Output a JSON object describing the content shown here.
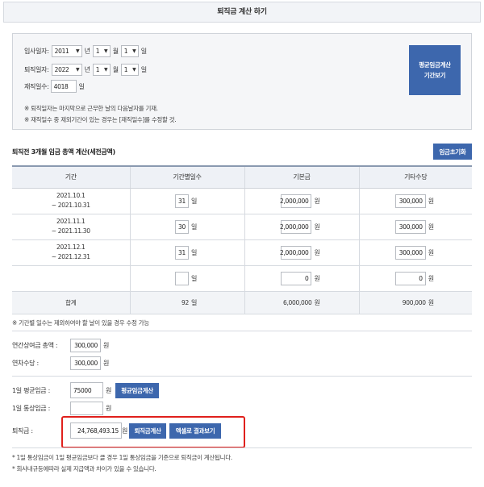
{
  "header": {
    "title": "퇴직금 계산 하기"
  },
  "dates": {
    "join_label": "입사일자:",
    "join_year": "2011",
    "join_month": "1",
    "join_day": "1",
    "leave_label": "퇴직일자:",
    "leave_year": "2022",
    "leave_month": "1",
    "leave_day": "1",
    "year_unit": "년",
    "month_unit": "월",
    "day_unit": "일",
    "days_label": "재직일수:",
    "days_value": "4018",
    "days_unit": "일",
    "note1": "※ 퇴직일자는 마지막으로 근무한 날의 다음날자를 기재.",
    "note2": "※ 재직일수 중 제외기간이 있는 경우는 [재직일수]를 수정할 것.",
    "period_button_line1": "평균임금계산",
    "period_button_line2": "기간보기"
  },
  "wages": {
    "title": "퇴직전 3개월 임금 총액 계산(세전금액)",
    "reset_button": "임금초기화",
    "columns": [
      "기간",
      "기간별일수",
      "기본금",
      "기타수당"
    ],
    "rows": [
      {
        "period_from": "2021.10.1",
        "period_to": "~ 2021.10.31",
        "days": "31",
        "base": "2,000,000",
        "other": "300,000"
      },
      {
        "period_from": "2021.11.1",
        "period_to": "~ 2021.11.30",
        "days": "30",
        "base": "2,000,000",
        "other": "300,000"
      },
      {
        "period_from": "2021.12.1",
        "period_to": "~ 2021.12.31",
        "days": "31",
        "base": "2,000,000",
        "other": "300,000"
      },
      {
        "period_from": "",
        "period_to": "",
        "days": "",
        "base": "0",
        "other": "0"
      }
    ],
    "day_unit": "일",
    "won_unit": "원",
    "sum_label": "합계",
    "sum_days": "92",
    "sum_base": "6,000,000",
    "sum_other": "900,000",
    "note": "※ 기간별 일수는 제외하여야 할 날이 있을 경우 수정 가능"
  },
  "bonus": {
    "annual_label": "연간상여금 총액 :",
    "annual_value": "300,000",
    "leave_label": "연차수당 :",
    "leave_value": "300,000",
    "unit": "원"
  },
  "result": {
    "avg_label": "1일 평균임금 :",
    "avg_value": "75000",
    "avg_button": "평균임금계산",
    "ordinary_label": "1일 통상임금 :",
    "ordinary_value": "",
    "severance_label": "퇴직금 :",
    "severance_value": "24,768,493.15",
    "unit": "원",
    "calc_button": "퇴직금계산",
    "excel_button": "엑셀로 결과보기",
    "note1": "* 1일 통상임금이 1일 평균임금보다 클 경우 1일 통상임금을 기준으로 퇴직금이 계산됩니다.",
    "note2": "* 회사내규등에따라 실제 지급액과 차이가 있을 수 있습니다."
  }
}
